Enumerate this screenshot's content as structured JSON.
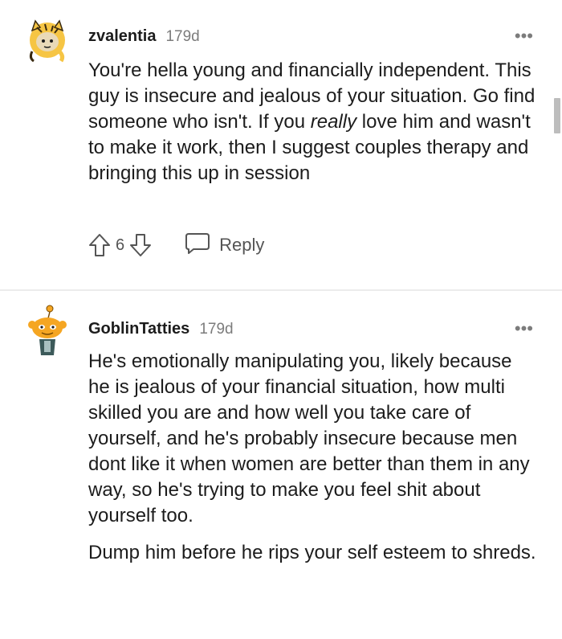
{
  "comments": [
    {
      "username": "zvalentia",
      "age": "179d",
      "more_label": "•••",
      "body_before_emph": "You're hella young and financially independent. This guy is insecure and jealous of your situation. Go find someone who isn't. If you ",
      "body_emph": "really",
      "body_after_emph": " love him and wasn't to make it work, then I suggest couples therapy and bringing this up in session",
      "score": "6",
      "reply_label": "Reply",
      "avatar_icon": "tiger-costume-avatar-icon"
    },
    {
      "username": "GoblinTatties",
      "age": "179d",
      "more_label": "•••",
      "paragraphs": [
        "He's emotionally manipulating you, likely because he is jealous of your financial situation, how multi skilled you are and how well you take care of yourself, and he's probably insecure because men dont like it when women are better than them in any way, so he's trying to make you feel shit about yourself too.",
        "Dump him before he rips your self esteem to shreds."
      ],
      "avatar_icon": "snoo-avatar-icon"
    }
  ],
  "colors": {
    "text": "#1c1c1c",
    "meta": "#7c7c7c",
    "action": "#555555",
    "divider": "#ececec",
    "avatar_orange": "#f5a623"
  }
}
